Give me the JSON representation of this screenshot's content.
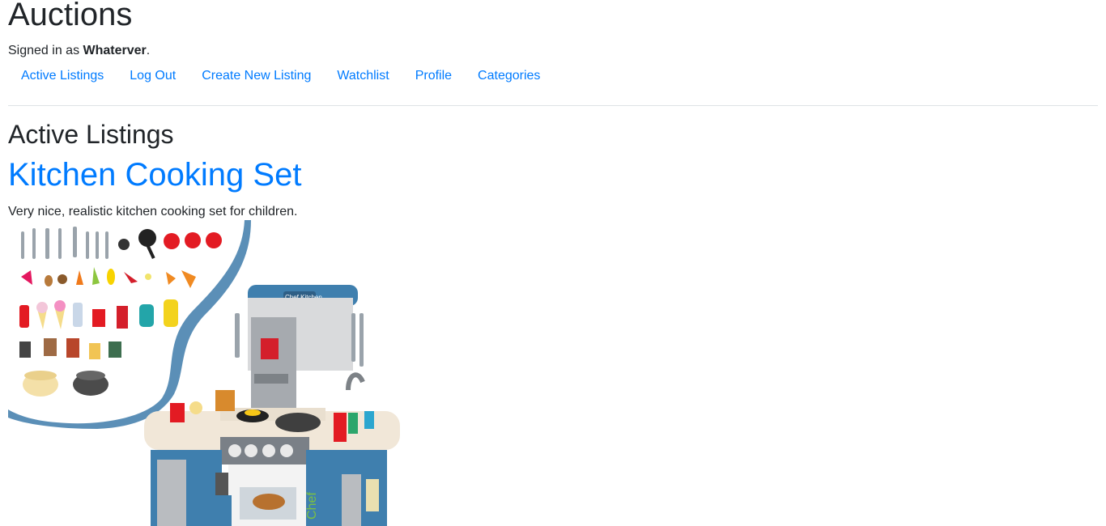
{
  "site": {
    "title": "Auctions"
  },
  "user": {
    "prefix": "Signed in as ",
    "name": "Whaterver",
    "suffix": "."
  },
  "nav": {
    "items": [
      {
        "label": "Active Listings"
      },
      {
        "label": "Log Out"
      },
      {
        "label": "Create New Listing"
      },
      {
        "label": "Watchlist"
      },
      {
        "label": "Profile"
      },
      {
        "label": "Categories"
      }
    ]
  },
  "page": {
    "heading": "Active Listings"
  },
  "listings": [
    {
      "title": "Kitchen Cooking Set",
      "description": "Very nice, realistic kitchen cooking set for children.",
      "image_icon": "toy-kitchen-image",
      "image_text": {
        "brand": "Chef Kitchen",
        "side": "Chef"
      }
    }
  ],
  "colors": {
    "link": "#007bff",
    "text": "#212529",
    "kitchen_blue": "#3f7fae",
    "kitchen_cream": "#f1e7d8"
  }
}
